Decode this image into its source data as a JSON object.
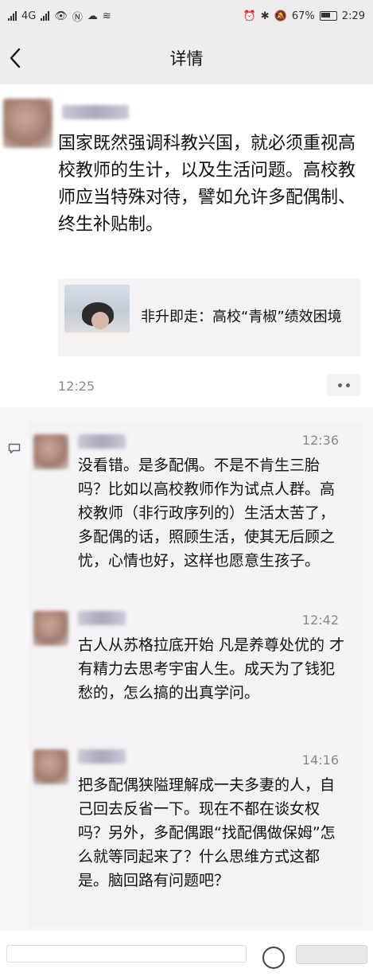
{
  "status_bar": {
    "left_text": "4G",
    "battery_percent": "67%",
    "time": "2:29"
  },
  "nav": {
    "title": "详情"
  },
  "post": {
    "text": "国家既然强调科教兴国，就必须重视高校教师的生计，以及生活问题。高校教师应当特殊对待，譬如允许多配偶制、终生补贴制。",
    "link_title": "非升即走：高校“青椒”绩效困境",
    "time": "12:25"
  },
  "comments": [
    {
      "time": "12:36",
      "text": "没看错。是多配偶。不是不肯生三胎吗？比如以高校教师作为试点人群。高校教师（非行政序列的）生活太苦了，多配偶的话，照顾生活，使其无后顾之忧，心情也好，这样也愿意生孩子。"
    },
    {
      "time": "12:42",
      "text": "古人从苏格拉底开始 凡是养尊处优的 才有精力去思考宇宙人生。成天为了钱犯愁的，怎么搞的出真学问。"
    },
    {
      "time": "14:16",
      "text": "把多配偶狭隘理解成一夫多妻的人，自己回去反省一下。现在不都在谈女权吗？另外，多配偶跟“找配偶做保姆”怎么就等同起来了？什么思维方式这都是。脑回路有问题吧？"
    }
  ]
}
